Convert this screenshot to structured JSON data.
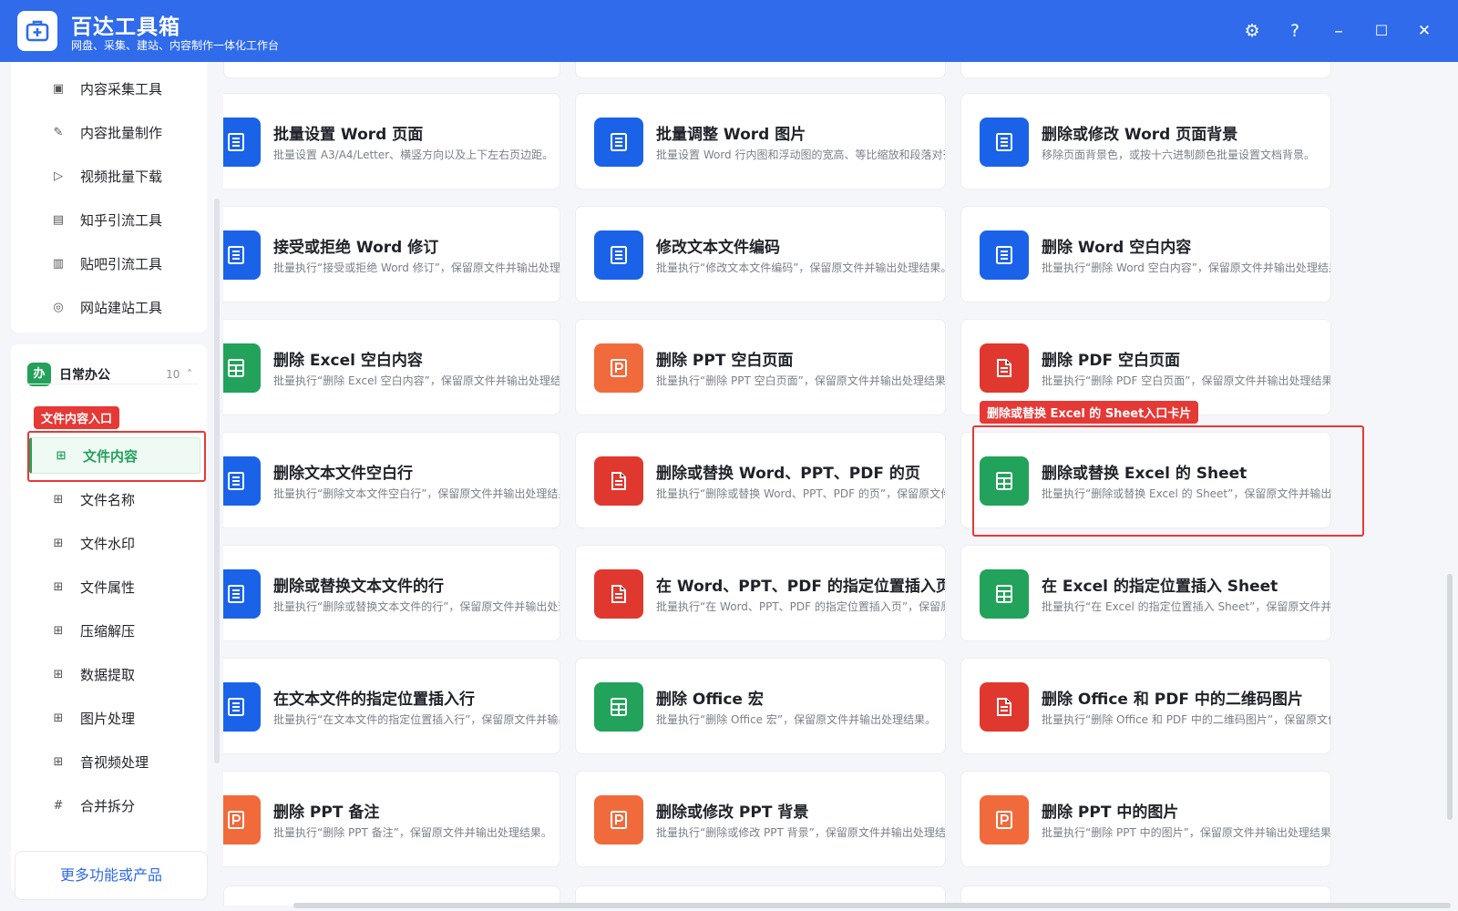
{
  "app": {
    "title": "百达工具箱",
    "subtitle": "网盘、采集、建站、内容制作一体化工作台"
  },
  "window": {
    "settings": "⚙",
    "help": "?",
    "minimize": "–",
    "maximize": "☐",
    "close": "✕"
  },
  "sidebar": {
    "top_items": [
      {
        "label": "内容采集工具",
        "icon": "collect-icon"
      },
      {
        "label": "内容批量制作",
        "icon": "edit-icon"
      },
      {
        "label": "视频批量下载",
        "icon": "video-icon"
      },
      {
        "label": "知乎引流工具",
        "icon": "zhihu-icon"
      },
      {
        "label": "贴吧引流工具",
        "icon": "tieba-icon"
      },
      {
        "label": "网站建站工具",
        "icon": "website-icon"
      }
    ],
    "group": {
      "badge": "办",
      "label": "日常办公",
      "count": "10",
      "chevron": "˄"
    },
    "group_items": [
      {
        "label": "文件内容"
      },
      {
        "label": "文件名称"
      },
      {
        "label": "文件水印"
      },
      {
        "label": "文件属性"
      },
      {
        "label": "压缩解压"
      },
      {
        "label": "数据提取"
      },
      {
        "label": "图片处理"
      },
      {
        "label": "音视频处理"
      },
      {
        "label": "合并拆分",
        "glyph": "#"
      }
    ],
    "more": "更多功能或产品"
  },
  "colors": {
    "word": "#1a63e8",
    "excel": "#22a25a",
    "ppt": "#f06a3c",
    "pdf": "#e0382f",
    "accent": "#2f6bea",
    "annotation": "#e53935"
  },
  "cards": [
    {
      "title": "批量设置 Word 页面",
      "desc": "批量设置 A3/A4/Letter、横竖方向以及上下左右页边距。",
      "kind": "word"
    },
    {
      "title": "批量调整 Word 图片",
      "desc": "批量设置 Word 行内图和浮动图的宽高、等比缩放和段落对齐。",
      "kind": "word"
    },
    {
      "title": "删除或修改 Word 页面背景",
      "desc": "移除页面背景色，或按十六进制颜色批量设置文档背景。",
      "kind": "word"
    },
    {
      "title": "接受或拒绝 Word 修订",
      "desc": "批量执行“接受或拒绝 Word 修订”，保留原文件并输出处理结果。",
      "kind": "word"
    },
    {
      "title": "修改文本文件编码",
      "desc": "批量执行“修改文本文件编码”，保留原文件并输出处理结果。",
      "kind": "word"
    },
    {
      "title": "删除 Word 空白内容",
      "desc": "批量执行“删除 Word 空白内容”，保留原文件并输出处理结果。",
      "kind": "word"
    },
    {
      "title": "删除 Excel 空白内容",
      "desc": "批量执行“删除 Excel 空白内容”，保留原文件并输出处理结果。",
      "kind": "excel"
    },
    {
      "title": "删除 PPT 空白页面",
      "desc": "批量执行“删除 PPT 空白页面”，保留原文件并输出处理结果。",
      "kind": "ppt"
    },
    {
      "title": "删除 PDF 空白页面",
      "desc": "批量执行“删除 PDF 空白页面”，保留原文件并输出处理结果。",
      "kind": "pdf"
    },
    {
      "title": "删除文本文件空白行",
      "desc": "批量执行“删除文本文件空白行”，保留原文件并输出处理结果。",
      "kind": "word"
    },
    {
      "title": "删除或替换 Word、PPT、PDF 的页",
      "desc": "批量执行“删除或替换 Word、PPT、PDF 的页”，保留原文件并输出处理结果。",
      "kind": "pdf"
    },
    {
      "title": "删除或替换 Excel 的 Sheet",
      "desc": "批量执行“删除或替换 Excel 的 Sheet”，保留原文件并输出处理结果。",
      "kind": "excel"
    },
    {
      "title": "删除或替换文本文件的行",
      "desc": "批量执行“删除或替换文本文件的行”，保留原文件并输出处理结果。",
      "kind": "word"
    },
    {
      "title": "在 Word、PPT、PDF 的指定位置插入页",
      "desc": "批量执行“在 Word、PPT、PDF 的指定位置插入页”，保留原文件并输出处理结果。",
      "kind": "pdf"
    },
    {
      "title": "在 Excel 的指定位置插入 Sheet",
      "desc": "批量执行“在 Excel 的指定位置插入 Sheet”，保留原文件并输出处理结果。",
      "kind": "excel"
    },
    {
      "title": "在文本文件的指定位置插入行",
      "desc": "批量执行“在文本文件的指定位置插入行”，保留原文件并输出处理结果。",
      "kind": "word"
    },
    {
      "title": "删除 Office 宏",
      "desc": "批量执行“删除 Office 宏”，保留原文件并输出处理结果。",
      "kind": "excel"
    },
    {
      "title": "删除 Office 和 PDF 中的二维码图片",
      "desc": "批量执行“删除 Office 和 PDF 中的二维码图片”，保留原文件并输出处理结果。",
      "kind": "pdf"
    },
    {
      "title": "删除 PPT 备注",
      "desc": "批量执行“删除 PPT 备注”，保留原文件并输出处理结果。",
      "kind": "ppt"
    },
    {
      "title": "删除或修改 PPT 背景",
      "desc": "批量执行“删除或修改 PPT 背景”，保留原文件并输出处理结果。",
      "kind": "ppt"
    },
    {
      "title": "删除 PPT 中的图片",
      "desc": "批量执行“删除 PPT 中的图片”，保留原文件并输出处理结果。",
      "kind": "ppt"
    }
  ],
  "annotations": {
    "sidebar_tag": "文件内容入口",
    "card_tag": "删除或替换 Excel 的 Sheet入口卡片"
  }
}
